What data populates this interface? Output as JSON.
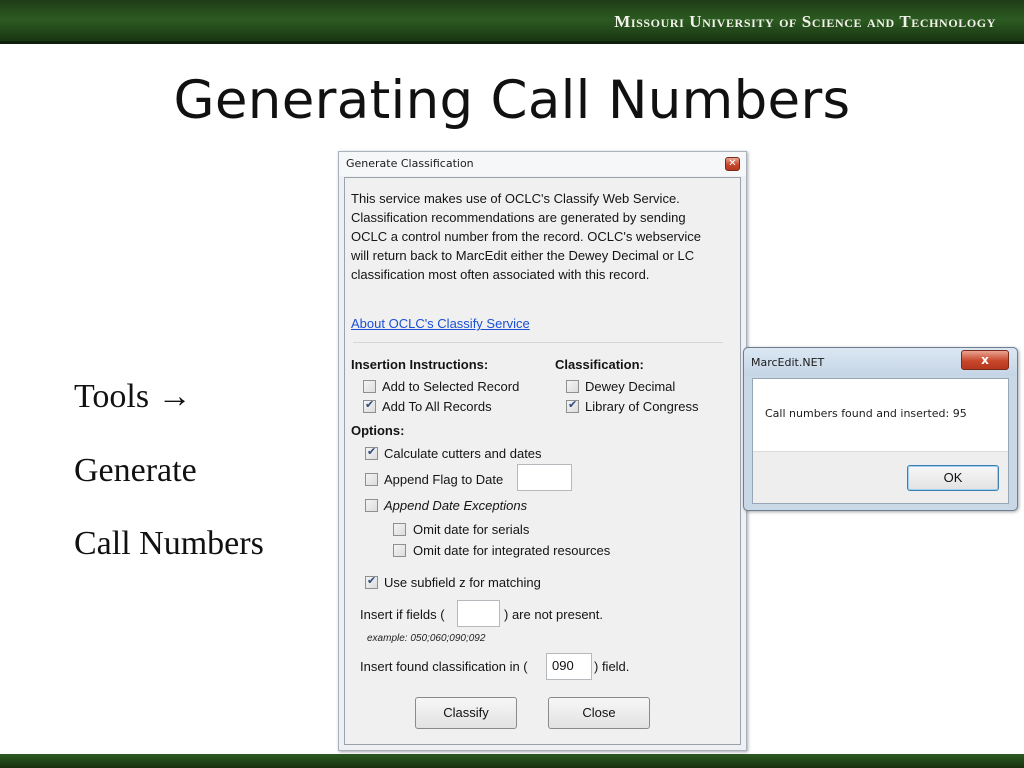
{
  "slide": {
    "banner": "Missouri University of Science and Technology",
    "title": "Generating Call Numbers",
    "side_lines": [
      "Tools →",
      "Generate",
      "Call Numbers"
    ]
  },
  "generate_dialog": {
    "title": "Generate Classification",
    "description": "This service makes use of OCLC's Classify Web Service. Classification recommendations are generated by sending OCLC a control number from the record.  OCLC's webservice will return back to MarcEdit either the Dewey Decimal or LC classification most often associated with this record.",
    "link": "About OCLC's Classify Service",
    "insertion_heading": "Insertion Instructions:",
    "insertion_options": [
      {
        "label": "Add to Selected Record",
        "checked": false
      },
      {
        "label": "Add To All Records",
        "checked": true
      }
    ],
    "classification_heading": "Classification:",
    "classification_options": [
      {
        "label": "Dewey Decimal",
        "checked": false
      },
      {
        "label": "Library of Congress",
        "checked": true
      }
    ],
    "options_heading": "Options:",
    "options": {
      "calc_cutters": {
        "label": "Calculate cutters and dates",
        "checked": true
      },
      "append_flag": {
        "label": "Append Flag to Date",
        "checked": false,
        "value": ""
      },
      "append_exceptions": {
        "label": "Append Date Exceptions",
        "checked": false
      },
      "omit_serials": {
        "label": "Omit date for serials",
        "checked": false
      },
      "omit_integrated": {
        "label": "Omit date for integrated resources",
        "checked": false
      },
      "subfield_z": {
        "label": "Use subfield z for matching",
        "checked": true
      }
    },
    "insert_if": {
      "before": "Insert if fields (",
      "value": "",
      "after": ") are not present."
    },
    "example": "example:  050;060;090;092",
    "insert_found": {
      "before": "Insert found classification in (",
      "value": "090",
      "after": ") field."
    },
    "classify_button": "Classify",
    "close_button": "Close"
  },
  "marcedit_dialog": {
    "title": "MarcEdit.NET",
    "close_glyph": "x",
    "message": "Call numbers found and inserted: 95",
    "ok_button": "OK"
  },
  "colors": {
    "banner_green": "#2c5a21",
    "link_blue": "#1a4fd6",
    "close_red": "#c8462b",
    "ok_focus_blue": "#3c7fb1"
  },
  "icons": [
    "close-icon",
    "checkbox-checked",
    "checkbox-unchecked"
  ]
}
